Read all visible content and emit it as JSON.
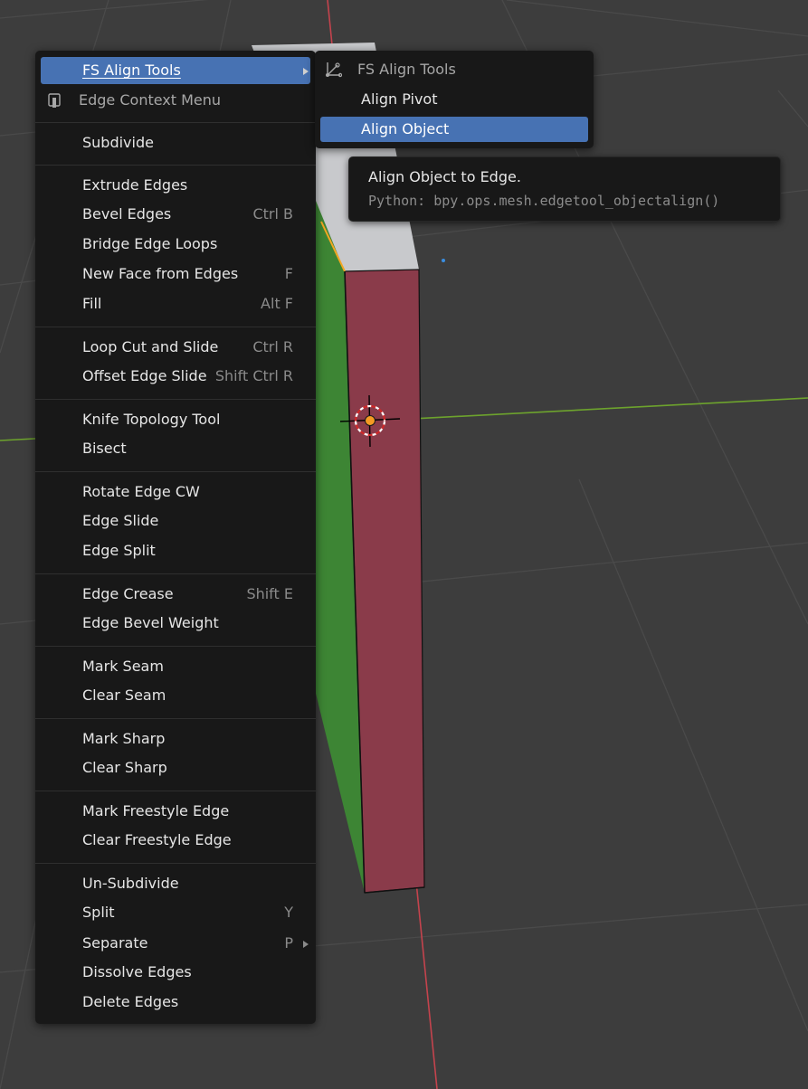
{
  "colors": {
    "viewport_bg": "#3d3d3d",
    "menu_bg": "#181818",
    "highlight": "#4772b3",
    "face_red": "#8a3b4a",
    "face_green": "#3d8534",
    "face_top": "#c8c9cc",
    "axis_x": "#d9444c",
    "axis_y": "#7fbf2d",
    "selected_edge": "#f5a623"
  },
  "menu": {
    "items": [
      {
        "label": "FS Align Tools",
        "shortcut": "",
        "has_submenu": true
      },
      {
        "label": "Edge Context Menu",
        "icon": "edge-context-icon"
      },
      {
        "label": "Subdivide",
        "shortcut": ""
      },
      {
        "label": "Extrude Edges",
        "shortcut": ""
      },
      {
        "label": "Bevel Edges",
        "shortcut": "Ctrl B"
      },
      {
        "label": "Bridge Edge Loops",
        "shortcut": ""
      },
      {
        "label": "New Face from Edges",
        "shortcut": "F"
      },
      {
        "label": "Fill",
        "shortcut": "Alt F"
      },
      {
        "label": "Loop Cut and Slide",
        "shortcut": "Ctrl R"
      },
      {
        "label": "Offset Edge Slide",
        "shortcut": "Shift Ctrl R"
      },
      {
        "label": "Knife Topology Tool",
        "shortcut": ""
      },
      {
        "label": "Bisect",
        "shortcut": ""
      },
      {
        "label": "Rotate Edge CW",
        "shortcut": ""
      },
      {
        "label": "Edge Slide",
        "shortcut": ""
      },
      {
        "label": "Edge Split",
        "shortcut": ""
      },
      {
        "label": "Edge Crease",
        "shortcut": "Shift E"
      },
      {
        "label": "Edge Bevel Weight",
        "shortcut": ""
      },
      {
        "label": "Mark Seam",
        "shortcut": ""
      },
      {
        "label": "Clear Seam",
        "shortcut": ""
      },
      {
        "label": "Mark Sharp",
        "shortcut": ""
      },
      {
        "label": "Clear Sharp",
        "shortcut": ""
      },
      {
        "label": "Mark Freestyle Edge",
        "shortcut": ""
      },
      {
        "label": "Clear Freestyle Edge",
        "shortcut": ""
      },
      {
        "label": "Un-Subdivide",
        "shortcut": ""
      },
      {
        "label": "Split",
        "shortcut": "Y"
      },
      {
        "label": "Separate",
        "shortcut": "P",
        "has_submenu": true
      },
      {
        "label": "Dissolve Edges",
        "shortcut": ""
      },
      {
        "label": "Delete Edges",
        "shortcut": ""
      }
    ]
  },
  "submenu": {
    "title": "FS Align Tools",
    "icon": "align-tools-icon",
    "items": [
      {
        "label": "Align Pivot"
      },
      {
        "label": "Align Object",
        "active": true
      }
    ]
  },
  "tooltip": {
    "description": "Align Object to Edge.",
    "python": "Python: bpy.ops.mesh.edgetool_objectalign()"
  }
}
